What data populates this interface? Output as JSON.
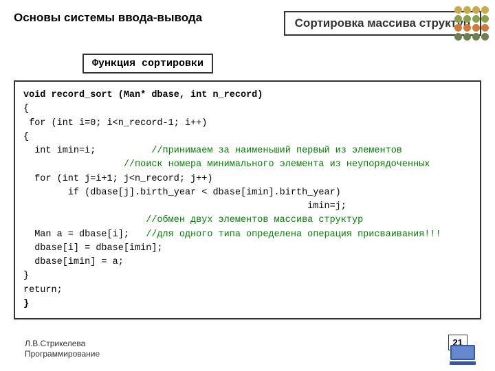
{
  "header": {
    "breadcrumb": "Основы системы ввода-вывода",
    "title": "Сортировка массива структур"
  },
  "subtitle": "Функция сортировки",
  "code": {
    "l1a": "void",
    "l1b": " record_sort (Man* dbase, ",
    "l1c": "int",
    "l1d": " n_record)",
    "l2": "{",
    "l3": " for (int i=0; i<n_record-1; i++)",
    "l4": "{",
    "l5a": "  int imin=i;          ",
    "l5b": "//принимаем за наименьший первый из элементов",
    "l6": "                  //поиск номера минимального элемента из неупорядоченных",
    "l7": "  for (int j=i+1; j<n_record; j++)",
    "l8": "        if (dbase[j].birth_year < dbase[imin].birth_year)",
    "l9": "                                                   imin=j;",
    "l10": "                      //обмен двух элементов массива структур",
    "l11a": "  Man a = dbase[i];   ",
    "l11b": "//для одного типа определена операция присваивания!!!",
    "l12": "  dbase[i] = dbase[imin];",
    "l13": "  dbase[imin] = a;",
    "l14": "}",
    "l15": "return;",
    "l16": "}"
  },
  "footer": {
    "author": "Л.В.Стрикелева",
    "course": "Программирование"
  },
  "page_number": "21",
  "dot_colors": {
    "r1": [
      "#c9a94a",
      "#c9a94a",
      "#c9a94a",
      "#c9a94a"
    ],
    "r2": [
      "#8aa04a",
      "#8aa04a",
      "#8aa04a",
      "#8aa04a"
    ],
    "r3": [
      "#d17a3a",
      "#d17a3a",
      "#d17a3a",
      "#d17a3a"
    ],
    "r4": [
      "#6a8050",
      "#6a8050",
      "#6a8050",
      "#6a8050"
    ]
  }
}
